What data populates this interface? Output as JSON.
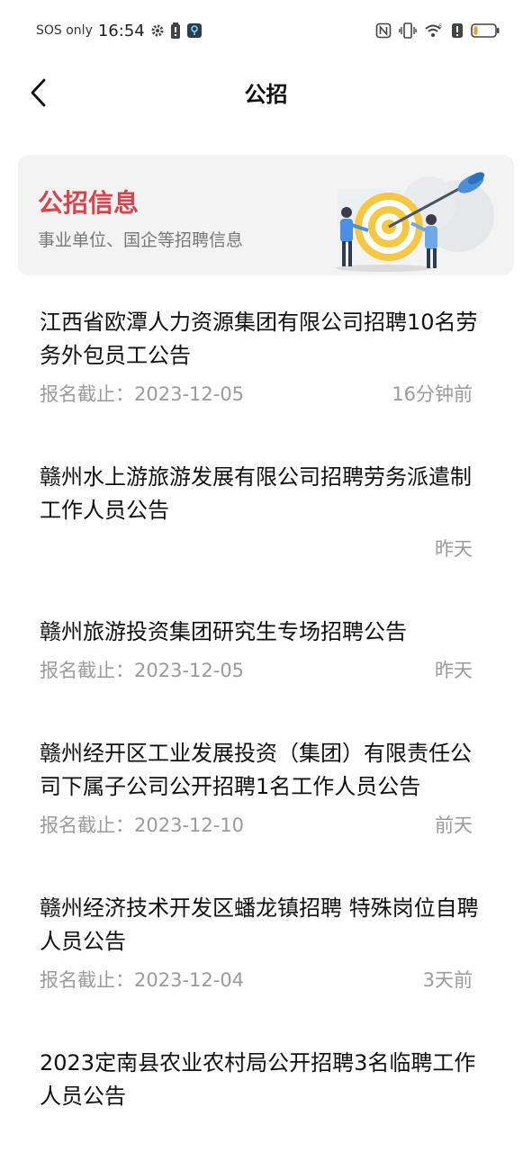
{
  "status_bar": {
    "carrier": "SOS only",
    "time": "16:54",
    "icons_left": [
      "gear-icon",
      "battery-alert-icon",
      "location-badge-icon"
    ],
    "icons_right": [
      "nfc-icon",
      "vibrate-icon",
      "wifi-6-icon",
      "alert-icon",
      "battery-low-icon"
    ],
    "battery_level": 0.18
  },
  "nav": {
    "title": "公招"
  },
  "banner": {
    "title": "公招信息",
    "subtitle": "事业单位、国企等招聘信息",
    "title_color": "#d9434c"
  },
  "items": [
    {
      "title": "江西省欧潭人力资源集团有限公司招聘10名劳务外包员工公告",
      "deadline": "报名截止：2023-12-05",
      "time": "16分钟前"
    },
    {
      "title": "赣州水上游旅游发展有限公司招聘劳务派遣制工作人员公告",
      "deadline": "",
      "time": "昨天"
    },
    {
      "title": "赣州旅游投资集团研究生专场招聘公告",
      "deadline": "报名截止：2023-12-05",
      "time": "昨天"
    },
    {
      "title": "赣州经开区工业发展投资（集团）有限责任公司下属子公司公开招聘1名工作人员公告",
      "deadline": "报名截止：2023-12-10",
      "time": "前天"
    },
    {
      "title": "赣州经济技术开发区蟠龙镇招聘 特殊岗位自聘人员公告",
      "deadline": "报名截止：2023-12-04",
      "time": "3天前"
    },
    {
      "title": "2023定南县农业农村局公开招聘3名临聘工作人员公告",
      "deadline": "",
      "time": ""
    }
  ]
}
